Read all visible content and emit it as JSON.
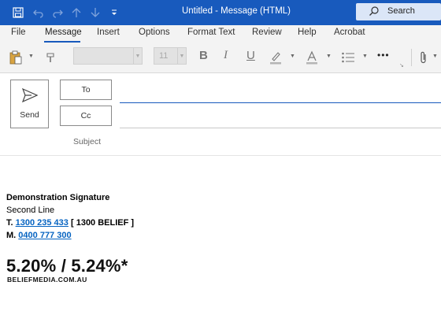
{
  "window": {
    "title": "Untitled  -  Message (HTML)"
  },
  "search": {
    "label": "Search"
  },
  "tabs": [
    "File",
    "Message",
    "Insert",
    "Options",
    "Format Text",
    "Review",
    "Help",
    "Acrobat"
  ],
  "ribbon": {
    "font_size": "11",
    "more": "•••"
  },
  "compose": {
    "send_label": "Send",
    "to_label": "To",
    "cc_label": "Cc",
    "subject_label": "Subject"
  },
  "signature": {
    "name": "Demonstration Signature",
    "line2": "Second Line",
    "phone_prefix": "T.",
    "phone": "1300 235 433",
    "phone_alt": "[ 1300 BELIEF ]",
    "mobile_prefix": "M.",
    "mobile": "0400 777 300",
    "rate": "5.20% / 5.24%*",
    "domain": "BELIEFMEDIA.COM.AU"
  },
  "colors": {
    "accent": "#185abd",
    "link": "#0563c1",
    "ribbon": "#f3f3f3"
  }
}
